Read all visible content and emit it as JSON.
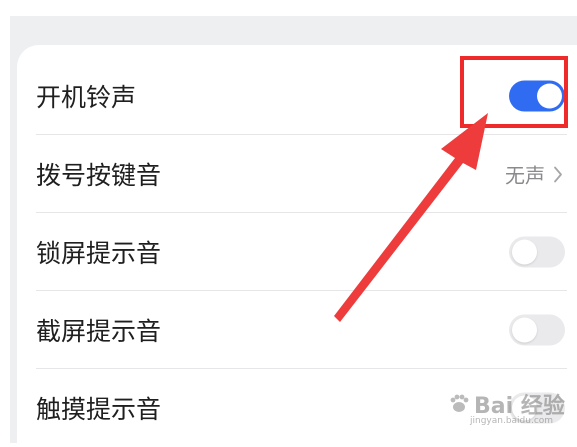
{
  "settings": {
    "rows": [
      {
        "label": "开机铃声",
        "toggle": "on"
      },
      {
        "label": "拨号按键音",
        "value": "无声"
      },
      {
        "label": "锁屏提示音",
        "toggle": "off"
      },
      {
        "label": "截屏提示音",
        "toggle": "off"
      },
      {
        "label": "触摸提示音",
        "toggle": "off"
      }
    ]
  },
  "watermark": {
    "text": "Bai 经验",
    "sub": "jingyan.baidu.com"
  },
  "colors": {
    "accent": "#2f6cf2",
    "annotation": "#ee2a2a"
  },
  "icons": [
    "chevron-right-icon",
    "annotation-arrow-icon",
    "baidu-paw-icon"
  ]
}
